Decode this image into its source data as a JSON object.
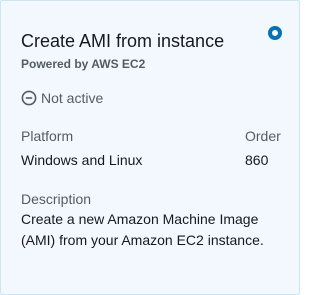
{
  "card": {
    "title": "Create AMI from instance",
    "subtitle": "Powered by AWS EC2",
    "selected": true,
    "status": {
      "icon": "minus-circle-icon",
      "text": "Not active"
    },
    "platform": {
      "label": "Platform",
      "value": "Windows and Linux"
    },
    "order": {
      "label": "Order",
      "value": "860"
    },
    "description": {
      "label": "Description",
      "value": "Create a new Amazon Machine Image (AMI) from your Amazon EC2 instance."
    }
  },
  "colors": {
    "card_background": "#f2f8fd",
    "card_border": "#c8e7f7",
    "accent": "#0073bb",
    "text_primary": "#16191f",
    "text_secondary": "#545b64"
  }
}
